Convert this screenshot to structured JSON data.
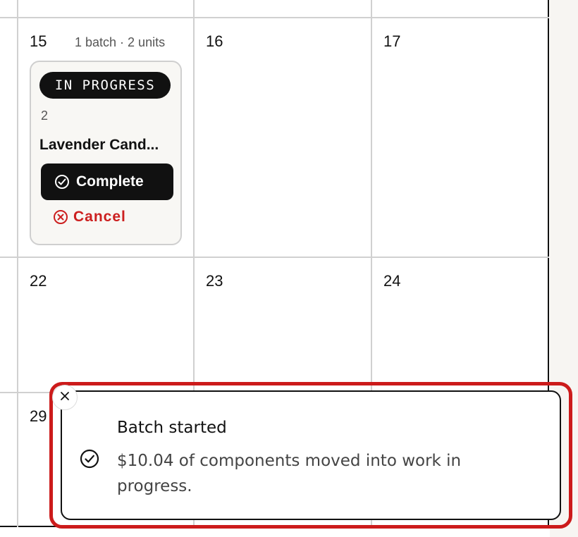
{
  "calendar": {
    "week1": {
      "cell1": {
        "day": "15",
        "meta": "1 batch · 2 units",
        "batch": {
          "status": "IN PROGRESS",
          "quantity": "2",
          "name": "Lavender Cand...",
          "complete_label": "Complete",
          "cancel_label": "Cancel"
        }
      },
      "cell2": {
        "day": "16"
      },
      "cell3": {
        "day": "17"
      }
    },
    "week2": {
      "cell1": {
        "day": "22"
      },
      "cell2": {
        "day": "23"
      },
      "cell3": {
        "day": "24"
      }
    },
    "week3": {
      "cell1": {
        "day": "29"
      }
    }
  },
  "toast": {
    "title": "Batch started",
    "description": "$10.04 of components moved into work in progress.",
    "icons": {
      "status": "check-circle-icon",
      "close": "close-icon"
    }
  },
  "colors": {
    "accent_dark": "#111111",
    "danger": "#cc1f1f",
    "highlight": "#cc1b1b"
  }
}
